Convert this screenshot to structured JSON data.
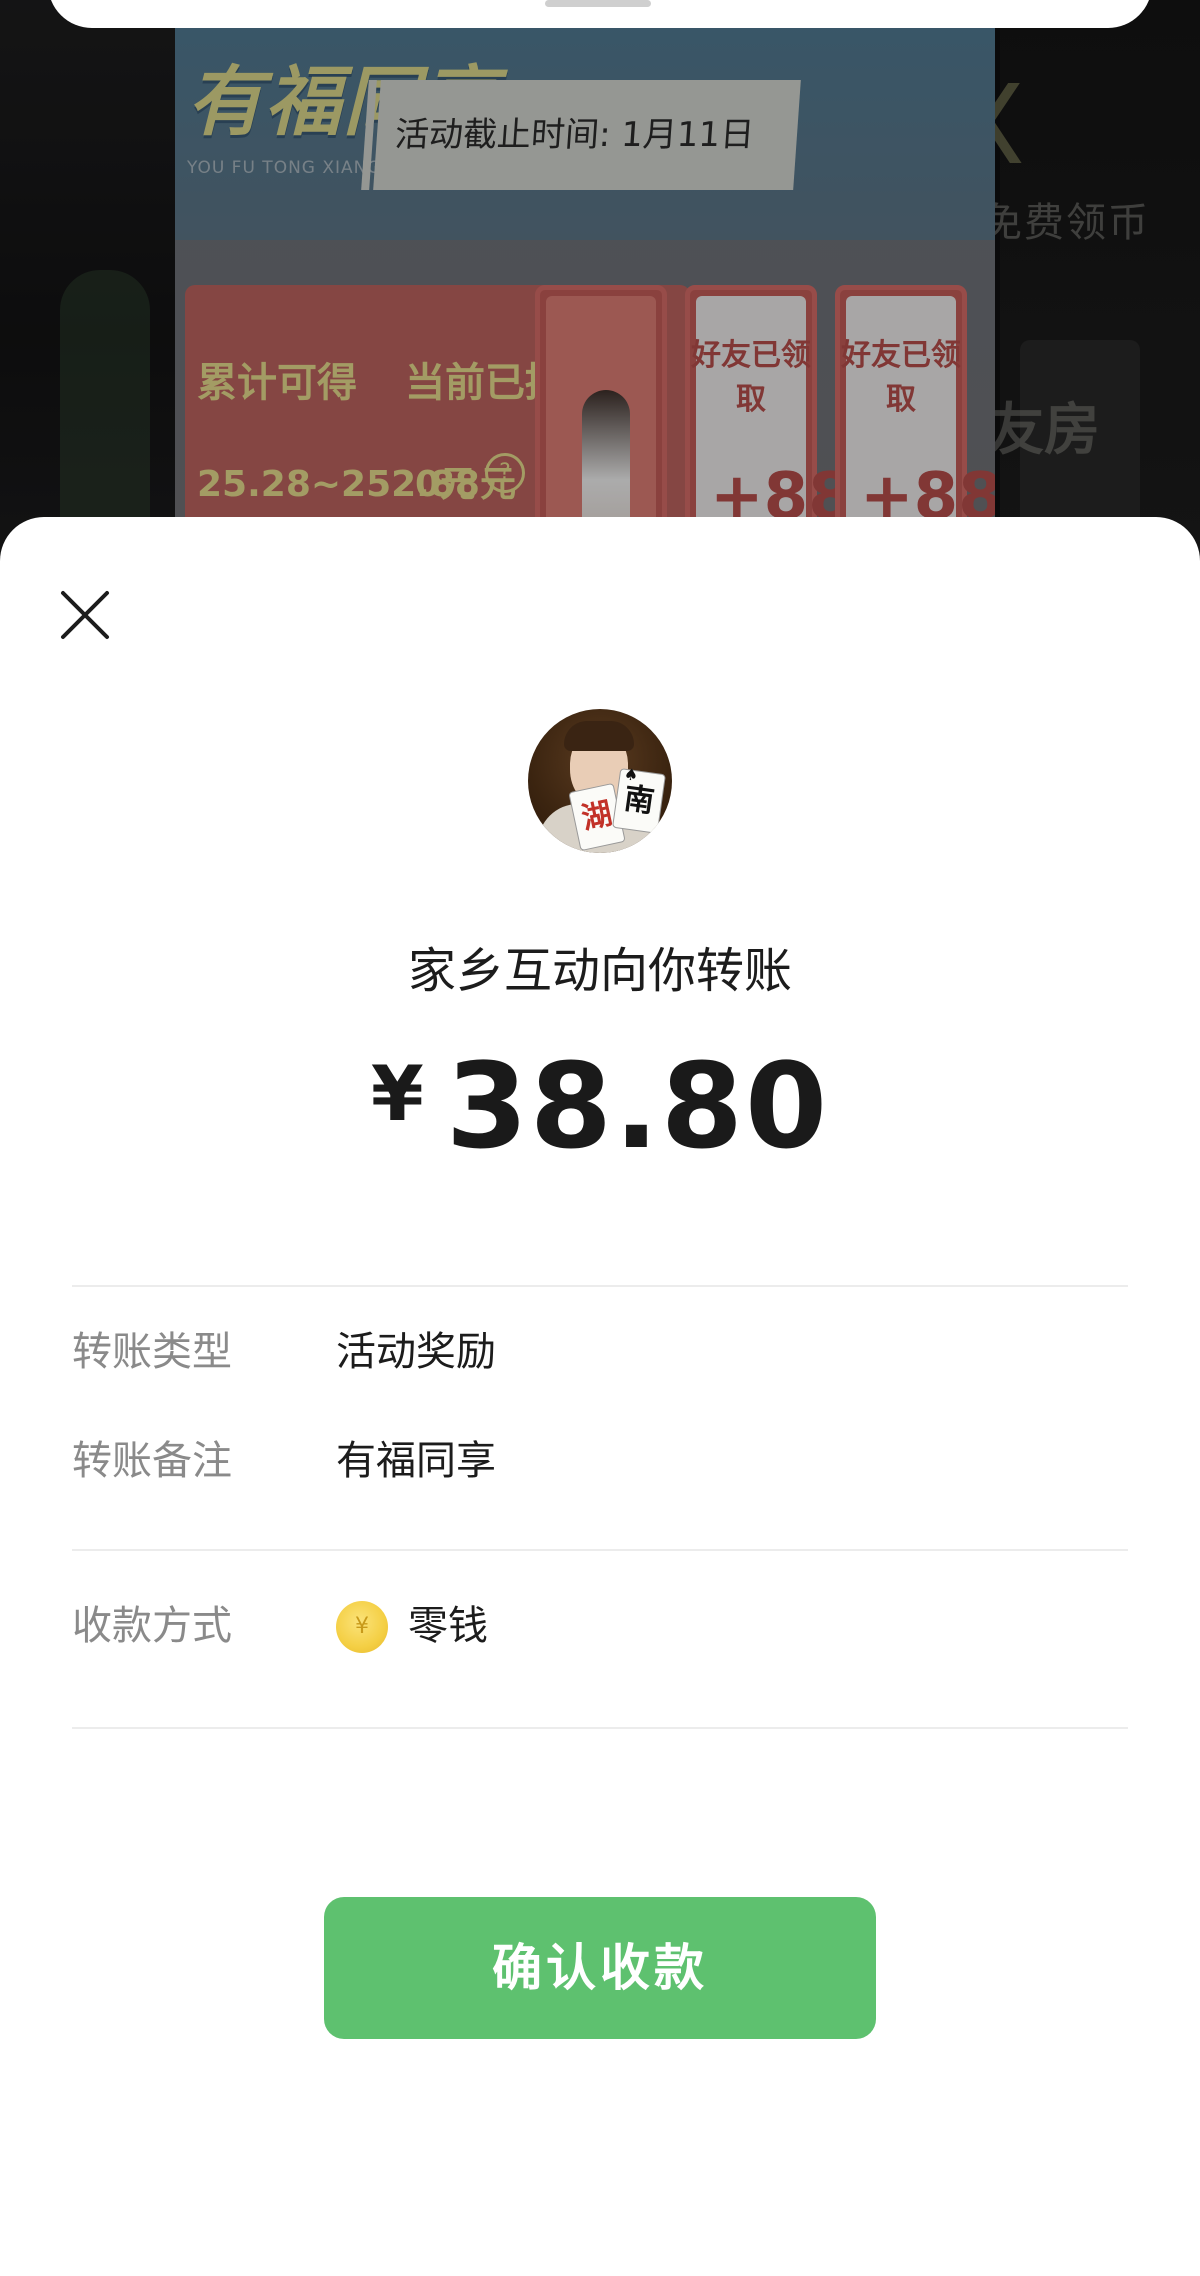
{
  "background": {
    "promo_title": "有福同享",
    "promo_subtitle": "YOU FU TONG XIANG",
    "deadline": "活动截止时间: 1月11日",
    "accumulate_label": "累计可得",
    "accumulate_value": "25.28~252.88元",
    "withdrawn_label": "当前已提取",
    "withdrawn_value": "0元",
    "help_glyph": "?",
    "friend_slot_label": "好友已领取",
    "friend_slot_value": "+88",
    "side_text_1": "免费领币",
    "side_text_2": "亲友房",
    "side_glyph": "X"
  },
  "avatar": {
    "card_1": "湖",
    "card_2": "南",
    "spade": "♠"
  },
  "sender_title": "家乡互动向你转账",
  "amount": {
    "currency": "¥",
    "value": "38.80"
  },
  "details": {
    "type_label": "转账类型",
    "type_value": "活动奖励",
    "note_label": "转账备注",
    "note_value": "有福同享",
    "method_label": "收款方式",
    "method_value": "零钱",
    "coin_glyph": "¥"
  },
  "confirm_button": "确认收款",
  "colors": {
    "accent_green": "#5ec16f",
    "coin_yellow": "#f4cf44"
  },
  "icons": {
    "close": "close-icon",
    "coin": "coin-icon"
  }
}
